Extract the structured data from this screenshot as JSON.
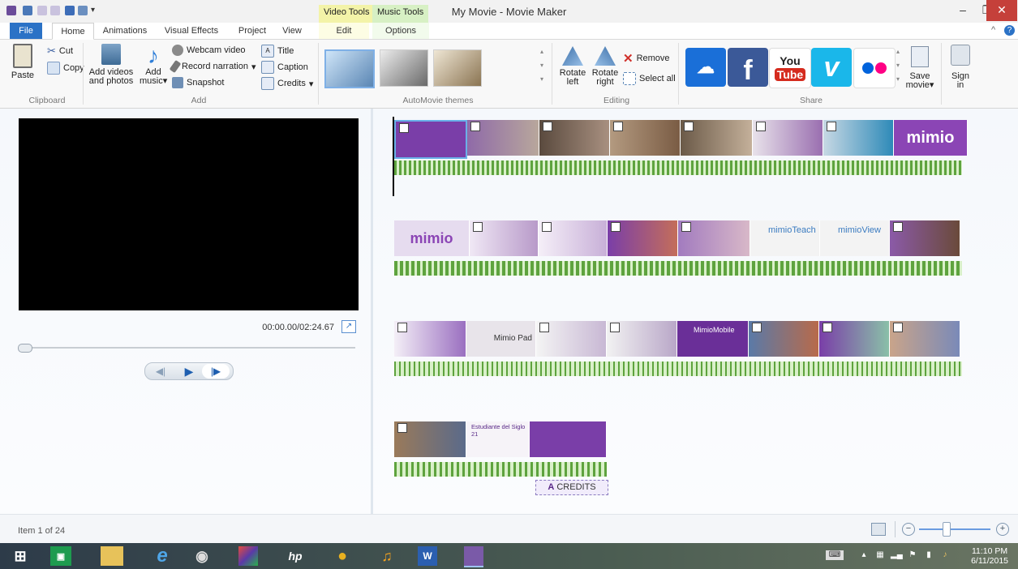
{
  "window": {
    "title": "My Movie - Movie Maker",
    "contextual_tabs": [
      "Video Tools",
      "Music Tools"
    ],
    "controls": [
      "minimize",
      "restore",
      "close"
    ]
  },
  "tabs": {
    "file": "File",
    "home": "Home",
    "animations": "Animations",
    "visual_effects": "Visual Effects",
    "project": "Project",
    "view": "View",
    "edit": "Edit",
    "options": "Options"
  },
  "ribbon": {
    "clipboard": {
      "label": "Clipboard",
      "paste": "Paste",
      "cut": "Cut",
      "copy": "Copy"
    },
    "add": {
      "label": "Add",
      "add_videos_1": "Add videos",
      "add_videos_2": "and photos",
      "add_music_1": "Add",
      "add_music_2": "music",
      "webcam": "Webcam video",
      "narration": "Record narration",
      "snapshot": "Snapshot",
      "title": "Title",
      "caption": "Caption",
      "credits": "Credits"
    },
    "themes": {
      "label": "AutoMovie themes"
    },
    "editing": {
      "label": "Editing",
      "rotate_left_1": "Rotate",
      "rotate_left_2": "left",
      "rotate_right_1": "Rotate",
      "rotate_right_2": "right",
      "remove": "Remove",
      "select_all": "Select all"
    },
    "share": {
      "label": "Share",
      "youtube_1": "You",
      "youtube_2": "Tube",
      "vimeo": "v",
      "facebook": "f",
      "save_movie_1": "Save",
      "save_movie_2": "movie",
      "sign_in_1": "Sign",
      "sign_in_2": "in"
    }
  },
  "preview": {
    "timecode": "00:00.00/02:24.67"
  },
  "storyboard": {
    "clip_text": {
      "mimio": "mimio",
      "mimio_teach": "mimioTeach",
      "mimio_view": "mimioView",
      "mimio_pad": "Mimio Pad",
      "mimio_mobile": "MimioMobile",
      "estudiante": "Estudiante del Siglo 21"
    },
    "credits_label": "CREDITS",
    "credits_icon": "A"
  },
  "status": {
    "item": "Item 1 of 24"
  },
  "taskbar": {
    "time": "11:10 PM",
    "date": "6/11/2015"
  },
  "colors": {
    "accent": "#2b72c6",
    "video_tools": "#f3f3a8",
    "music_tools": "#d7f0c4",
    "purple": "#7a3ea8"
  }
}
